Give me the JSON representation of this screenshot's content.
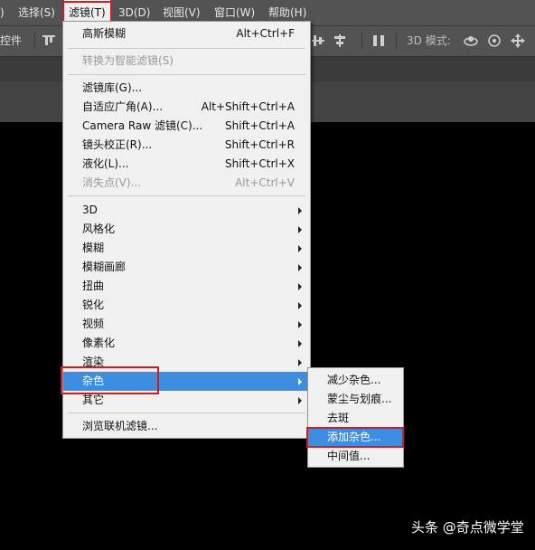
{
  "menubar": {
    "items": [
      {
        "label": ")"
      },
      {
        "label": "选择(S)"
      },
      {
        "label": "滤镜(T)"
      },
      {
        "label": "3D(D)"
      },
      {
        "label": "视图(V)"
      },
      {
        "label": "窗口(W)"
      },
      {
        "label": "帮助(H)"
      }
    ]
  },
  "options_bar": {
    "left_label": "控件",
    "mode_label": "3D 模式:"
  },
  "filter_menu": {
    "items": [
      {
        "label": "高斯模糊",
        "shortcut": "Alt+Ctrl+F"
      },
      {
        "label": "转换为智能滤镜(S)"
      },
      {
        "label": "滤镜库(G)..."
      },
      {
        "label": "自适应广角(A)...",
        "shortcut": "Alt+Shift+Ctrl+A"
      },
      {
        "label": "Camera Raw 滤镜(C)...",
        "shortcut": "Shift+Ctrl+A"
      },
      {
        "label": "镜头校正(R)...",
        "shortcut": "Shift+Ctrl+R"
      },
      {
        "label": "液化(L)...",
        "shortcut": "Shift+Ctrl+X"
      },
      {
        "label": "消失点(V)...",
        "shortcut": "Alt+Ctrl+V"
      },
      {
        "label": "3D"
      },
      {
        "label": "风格化"
      },
      {
        "label": "模糊"
      },
      {
        "label": "模糊画廊"
      },
      {
        "label": "扭曲"
      },
      {
        "label": "锐化"
      },
      {
        "label": "视频"
      },
      {
        "label": "像素化"
      },
      {
        "label": "渲染"
      },
      {
        "label": "杂色"
      },
      {
        "label": "其它"
      },
      {
        "label": "浏览联机滤镜..."
      }
    ]
  },
  "noise_submenu": {
    "items": [
      {
        "label": "减少杂色..."
      },
      {
        "label": "蒙尘与划痕..."
      },
      {
        "label": "去斑"
      },
      {
        "label": "添加杂色..."
      },
      {
        "label": "中间值..."
      }
    ]
  },
  "watermark": "头条 @奇点微学堂",
  "colors": {
    "highlight": "#3d8ee0",
    "annotation_red": "#d01e1e",
    "menu_bg": "#f0f0f0"
  }
}
